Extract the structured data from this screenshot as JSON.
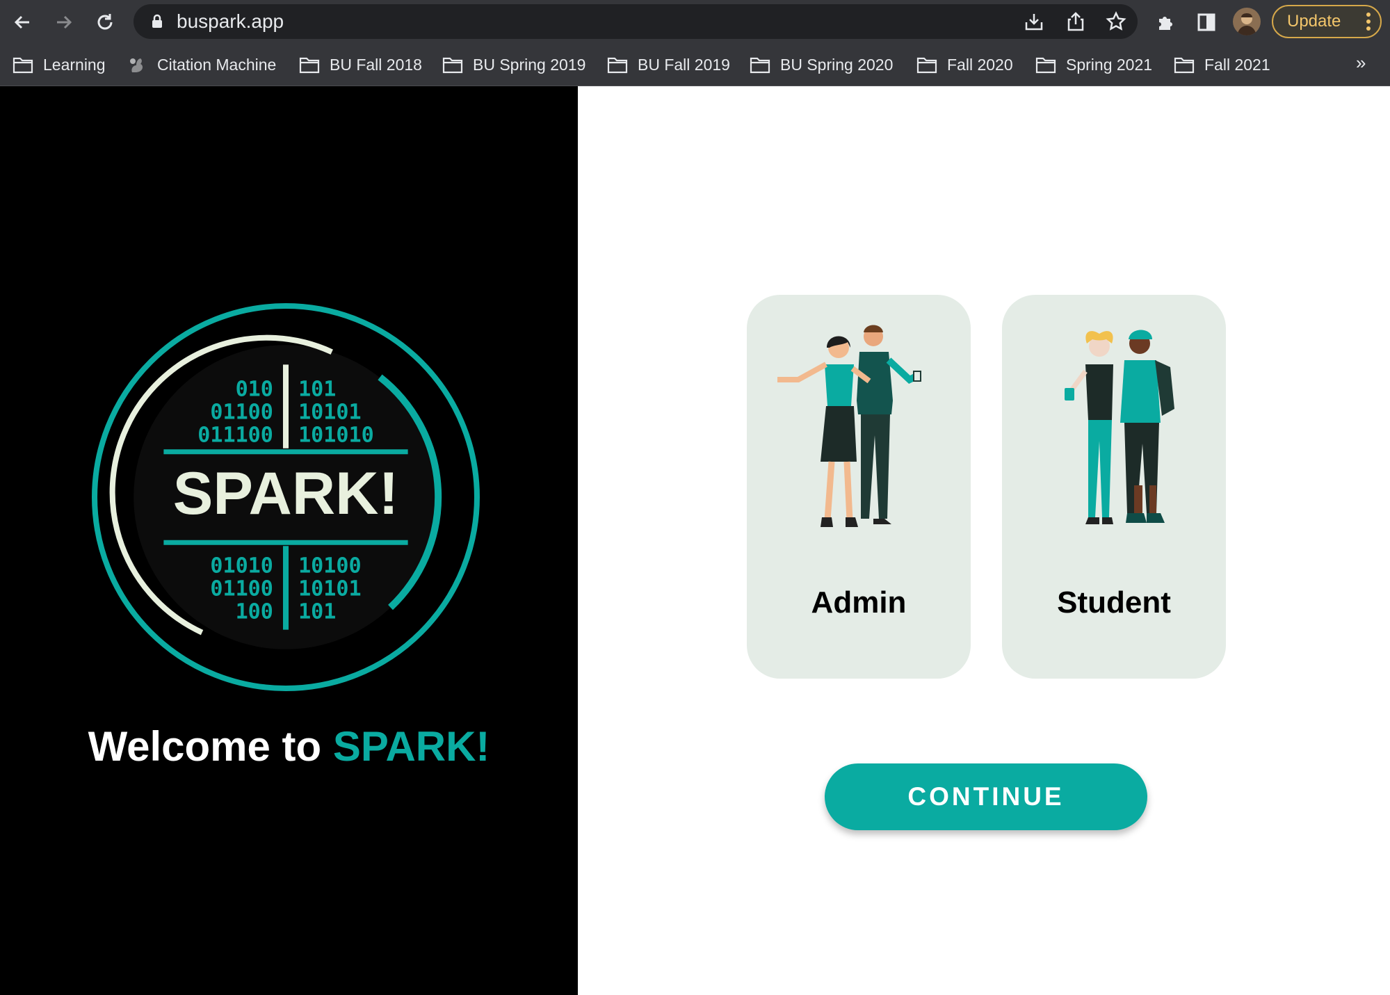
{
  "browser": {
    "url": "buspark.app",
    "update_label": "Update",
    "bookmarks": [
      "Learning",
      "Citation Machine",
      "BU Fall 2018",
      "BU Spring 2019",
      "BU Fall 2019",
      "BU Spring 2020",
      "Fall 2020",
      "Spring 2021",
      "Fall 2021"
    ],
    "more_label": "»",
    "icons": [
      "back-arrow-icon",
      "forward-arrow-icon",
      "reload-icon",
      "lock-icon",
      "install-icon",
      "share-icon",
      "star-icon",
      "extensions-icon",
      "side-panel-icon",
      "profile-avatar",
      "more-vert-icon",
      "folder-icon"
    ]
  },
  "page": {
    "welcome_prefix": "Welcome to ",
    "welcome_brand": "SPARK!",
    "logo_text": "SPARK!",
    "logo_binary": {
      "top_left": [
        "010",
        "01100",
        "011100"
      ],
      "top_right": [
        "101",
        "10101",
        "101010"
      ],
      "bottom_left": [
        "01010",
        "01100",
        "100"
      ],
      "bottom_right": [
        "10100",
        "10101",
        "101"
      ]
    },
    "roles": [
      {
        "label": "Admin"
      },
      {
        "label": "Student"
      }
    ],
    "continue_label": "CONTINUE"
  },
  "colors": {
    "accent": "#0aaba1",
    "card_bg": "#e4ece6",
    "chrome_bg": "#35363a",
    "logo_cream": "#e8f0de"
  }
}
